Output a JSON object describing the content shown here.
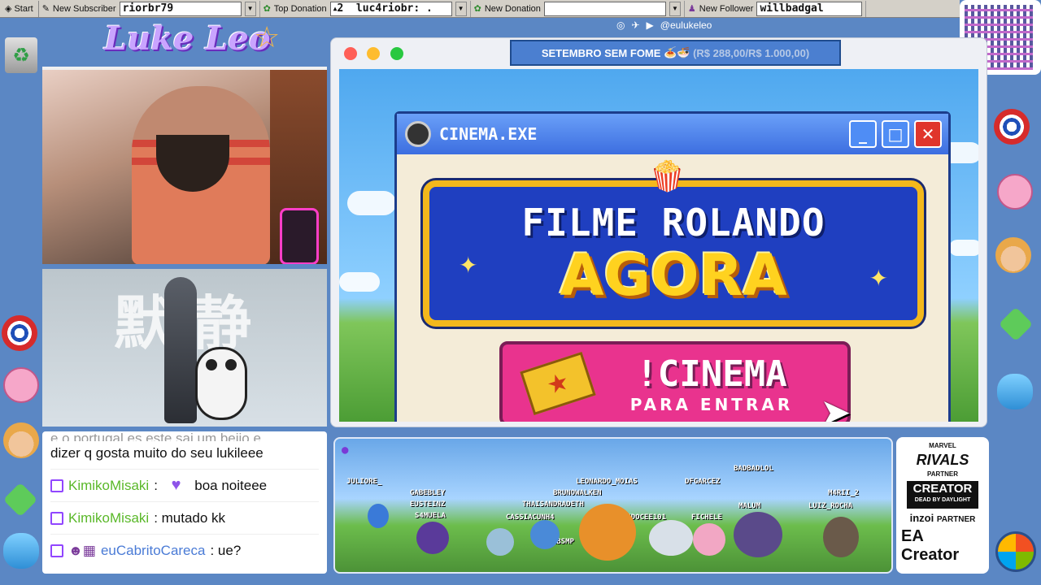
{
  "taskbar": {
    "start_label": "Start",
    "subscriber_label": "New Subscriber",
    "subscriber_value": "riorbr79",
    "top_donation_label": "Top Donation",
    "top_donation_rank": "2",
    "top_donation_value": "luc4riobr: .",
    "new_donation_label": "New Donation",
    "new_donation_value": "",
    "follower_label": "New Follower",
    "follower_value": "willbadgal"
  },
  "branding": {
    "logo": "Luke Leo",
    "handle": "@eulukeleo"
  },
  "donation_goal": {
    "campaign": "SETEMBRO SEM FOME",
    "emojis": "🍝🍜",
    "progress_text": "(R$ 288,00/R$ 1.000,00)",
    "current": 288,
    "target": 1000
  },
  "cinema_window": {
    "title": "CINEMA.EXE",
    "headline_1": "FILME ROLANDO",
    "headline_2": "AGORA",
    "cta_command": "!CINEMA",
    "cta_sub": "PARA ENTRAR"
  },
  "chat": {
    "partial_line": "e o portugal es este sai um beijo e",
    "first_line": "dizer q gosta muito do seu lukileee",
    "messages": [
      {
        "user": "KimikoMisaki",
        "text": "boa noiteee",
        "color": "#5ab829"
      },
      {
        "user": "KimikoMisaki",
        "text": ": mutado kk",
        "color": "#5ab829"
      },
      {
        "user": "euCabritoCareca",
        "text": ": ue?",
        "color": "#4a7bd6"
      }
    ]
  },
  "scene_names": [
    "JULIORE_",
    "GABEBLEY",
    "EUSTEINZ",
    "S4MUELA",
    "LEONARDO_MOIAS",
    "BRUNOWALKEN",
    "THAISANDRADETH",
    "CASSIACUNH4",
    "AGRIDOCEE101",
    "DFGARCEZ",
    "BADBADLOL",
    "FICHELE",
    "MALUM",
    "M4RII_2",
    "LUIZ_ROCHA",
    "GURBSMP"
  ],
  "partners": {
    "rivals": "RIVALS",
    "rivals_sub": "MARVEL",
    "rivals_tag": "PARTNER",
    "creator": "CREATOR",
    "creator_sub": "DEAD BY DAYLIGHT",
    "inzoi": "inzoi",
    "inzoi_tag": "PARTNER",
    "ea": "EA Creator"
  }
}
